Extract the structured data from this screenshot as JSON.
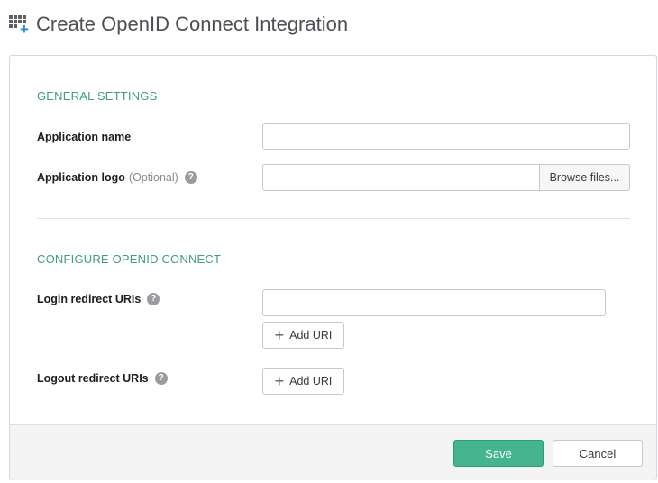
{
  "header": {
    "title": "Create OpenID Connect Integration",
    "icon": "app-grid-add-icon",
    "icon_accent": "#1f8fd6"
  },
  "general_settings": {
    "title": "GENERAL SETTINGS",
    "app_name": {
      "label": "Application name",
      "value": "",
      "placeholder": ""
    },
    "app_logo": {
      "label": "Application logo",
      "optional": "(Optional)",
      "help": "?",
      "value": "",
      "browse_label": "Browse files..."
    }
  },
  "openid_config": {
    "title": "CONFIGURE OPENID CONNECT",
    "login_redirect": {
      "label": "Login redirect URIs",
      "help": "?",
      "value": "",
      "add_label": "Add URI"
    },
    "logout_redirect": {
      "label": "Logout redirect URIs",
      "help": "?",
      "add_label": "Add URI"
    }
  },
  "footer": {
    "save_label": "Save",
    "cancel_label": "Cancel"
  },
  "colors": {
    "section_title": "#3e9c87",
    "primary_button": "#45b58f",
    "help_icon": "#9a9aa0"
  }
}
